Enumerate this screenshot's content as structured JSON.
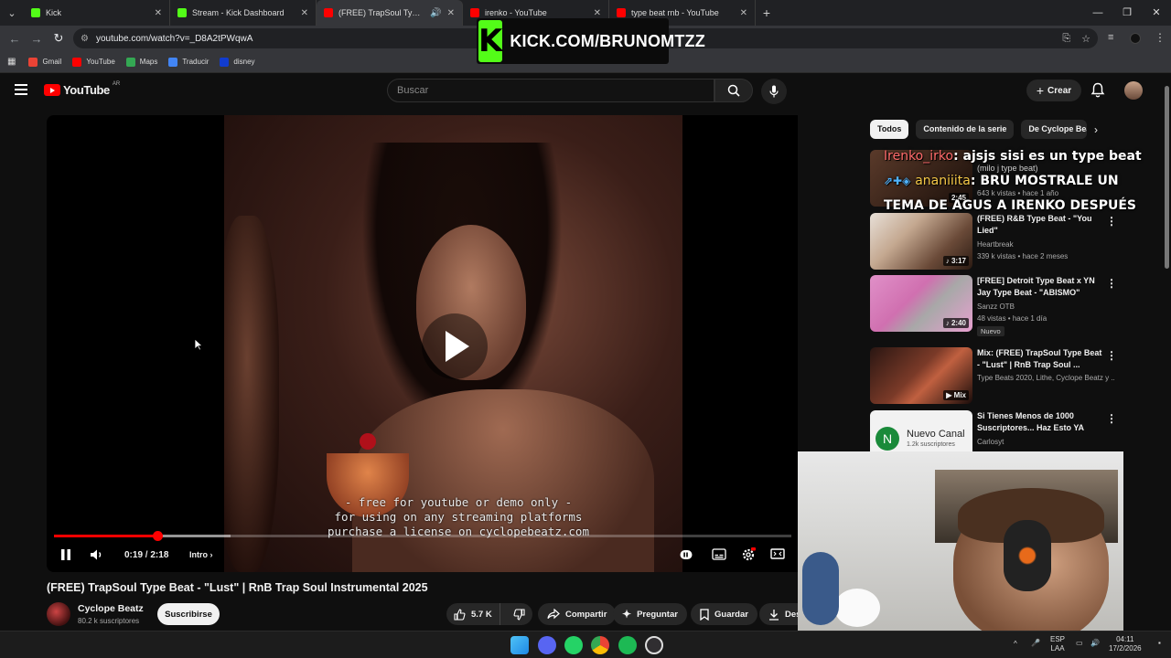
{
  "browser": {
    "tabs": [
      {
        "title": "Kick",
        "color": "#53fc18",
        "active": false
      },
      {
        "title": "Stream - Kick Dashboard",
        "color": "#53fc18",
        "active": false
      },
      {
        "title": "(FREE) TrapSoul Type Beat",
        "color": "#ff0000",
        "active": true
      },
      {
        "title": "irenko - YouTube",
        "color": "#ff0000",
        "active": false
      },
      {
        "title": "type beat rnb - YouTube",
        "color": "#ff0000",
        "active": false
      }
    ],
    "url": "youtube.com/watch?v=_D8A2tPWqwA",
    "bookmarks": [
      {
        "label": "Gmail",
        "color": "#ea4335"
      },
      {
        "label": "YouTube",
        "color": "#ff0000"
      },
      {
        "label": "Maps",
        "color": "#34a853"
      },
      {
        "label": "Traducir",
        "color": "#4285f4"
      },
      {
        "label": "disney",
        "color": "#113ccf"
      }
    ]
  },
  "kick_banner": {
    "url_text": "KICK.COM/BRUNOMTZZ",
    "logo_letter": "K",
    "accent": "#53fc18"
  },
  "youtube": {
    "logo_text": "YouTube",
    "region": "AR",
    "search_placeholder": "Buscar",
    "create_label": "Crear"
  },
  "player": {
    "caption_lines": [
      "- free for youtube or demo only -",
      "for using on any streaming platforms",
      "purchase a license on cyclopebeatz.com"
    ],
    "current_time": "0:19",
    "duration": "2:18",
    "progress_fraction": 0.14,
    "buffer_fraction": 0.24,
    "chapter": "Intro",
    "time_sep": "/"
  },
  "video": {
    "title": "(FREE) TrapSoul Type Beat - \"Lust\" | RnB Trap Soul Instrumental 2025",
    "channel": "Cyclope Beatz",
    "subscribers": "80.2 k suscriptores",
    "subscribe_label": "Suscribirse",
    "likes": "5.7 K",
    "share_label": "Compartir",
    "ask_label": "Preguntar",
    "save_label": "Guardar",
    "download_label": "Des"
  },
  "chips": [
    "Todos",
    "Contenido de la serie",
    "De Cyclope Beatz"
  ],
  "recommendations": [
    {
      "title": "(milo j type beat)",
      "channel": "",
      "meta": "643 k vistas • hace 1 año",
      "duration": "2:45",
      "badge": ""
    },
    {
      "title": "(FREE) R&B Type Beat - \"You Lied\"",
      "channel": "Heartbreak",
      "meta": "339 k vistas • hace 2 meses",
      "duration": "3:17",
      "badge": ""
    },
    {
      "title": "[FREE] Detroit Type Beat x YN Jay Type Beat - \"ABISMO\"",
      "channel": "Sanzz OTB",
      "meta": "48 vistas • hace 1 día",
      "duration": "2:40",
      "badge": "Nuevo"
    },
    {
      "title": "Mix: (FREE) TrapSoul Type Beat - \"Lust\" | RnB Trap Soul ...",
      "channel": "Type Beats 2020, Lithe, Cyclope Beatz y ...",
      "meta": "",
      "duration": "Mix",
      "badge": ""
    },
    {
      "title": "Si Tienes Menos de 1000 Suscriptores... Haz Esto YA",
      "channel": "Carlosyt",
      "meta": "",
      "duration": "",
      "badge": "",
      "thumb_text": "Nuevo Canal",
      "thumb_sub": "1.2k suscriptores",
      "thumb_letter": "N"
    }
  ],
  "chat": [
    {
      "user": "Irenko_irko",
      "message": ": ajsjs sisi es un type beat"
    },
    {
      "user": "ananiiita",
      "message": ": BRU MOSTRALE UN TEMA DE AGUS A IRENKO DESPUÉS"
    }
  ],
  "taskbar": {
    "lang": "ESP",
    "lang2": "LAA",
    "time": "04:11",
    "date": "17/2/2026"
  },
  "colors": {
    "yt_red": "#ff0000",
    "kick_green": "#53fc18",
    "bg": "#0f0f0f"
  }
}
